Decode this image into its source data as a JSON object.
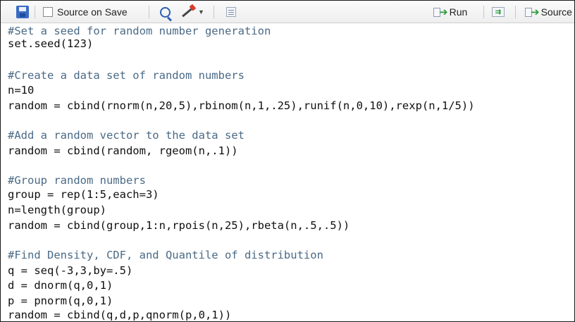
{
  "toolbar": {
    "source_on_save_label": "Source on Save",
    "source_on_save_checked": false,
    "run_label": "Run",
    "source_label": "Source",
    "icons": [
      "save-icon",
      "checkbox",
      "search-icon",
      "code-tools-wand-icon",
      "chevron-down-icon",
      "compile-report-icon",
      "run-arrow-icon",
      "rerun-icon",
      "source-arrow-icon"
    ]
  },
  "editor": {
    "lines": [
      {
        "kind": "comment",
        "text": "#Set a seed for random number generation"
      },
      {
        "kind": "code",
        "text": "set.seed(123)"
      },
      {
        "kind": "blank",
        "text": ""
      },
      {
        "kind": "comment",
        "text": "#Create a data set of random numbers"
      },
      {
        "kind": "code",
        "text": "n=10"
      },
      {
        "kind": "code",
        "text": "random = cbind(rnorm(n,20,5),rbinom(n,1,.25),runif(n,0,10),rexp(n,1/5))"
      },
      {
        "kind": "blank",
        "text": ""
      },
      {
        "kind": "comment",
        "text": "#Add a random vector to the data set"
      },
      {
        "kind": "code",
        "text": "random = cbind(random, rgeom(n,.1))"
      },
      {
        "kind": "blank",
        "text": ""
      },
      {
        "kind": "comment",
        "text": "#Group random numbers"
      },
      {
        "kind": "code",
        "text": "group = rep(1:5,each=3)"
      },
      {
        "kind": "code",
        "text": "n=length(group)"
      },
      {
        "kind": "code",
        "text": "random = cbind(group,1:n,rpois(n,25),rbeta(n,.5,.5))"
      },
      {
        "kind": "blank",
        "text": ""
      },
      {
        "kind": "comment",
        "text": "#Find Density, CDF, and Quantile of distribution"
      },
      {
        "kind": "code",
        "text": "q = seq(-3,3,by=.5)"
      },
      {
        "kind": "code",
        "text": "d = dnorm(q,0,1)"
      },
      {
        "kind": "code",
        "text": "p = pnorm(q,0,1)"
      },
      {
        "kind": "code",
        "text": "random = cbind(q,d,p,qnorm(p,0,1))"
      }
    ]
  },
  "colors": {
    "comment": "#4a6a86",
    "code": "#101010",
    "run_arrow": "#2a9a3a",
    "save_icon": "#3b6cc4"
  }
}
